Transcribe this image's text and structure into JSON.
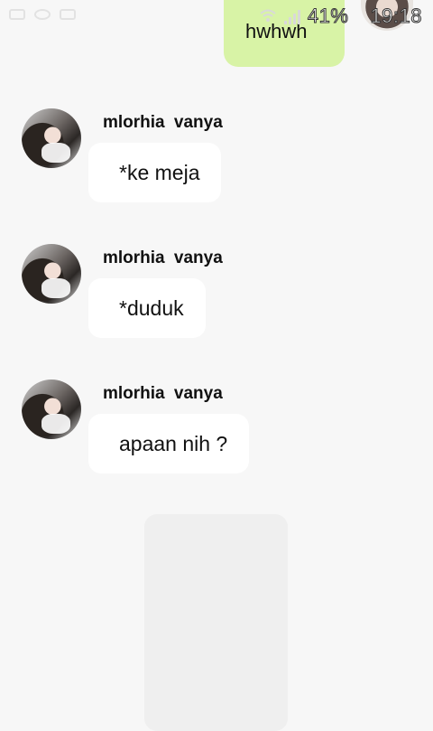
{
  "status_bar": {
    "battery": "41%",
    "time": "19:18",
    "icons": [
      "screen-icon",
      "chat-icon",
      "mail-icon",
      "wifi-icon",
      "signal-icon"
    ]
  },
  "outgoing": {
    "text": "hwhwh",
    "color": "#d8f3a6"
  },
  "messages": [
    {
      "name": "mlorhia  vanya",
      "text": "*ke meja"
    },
    {
      "name": "mlorhia  vanya",
      "text": "*duduk"
    },
    {
      "name": "mlorhia  vanya",
      "text": "apaan nih ?"
    }
  ]
}
